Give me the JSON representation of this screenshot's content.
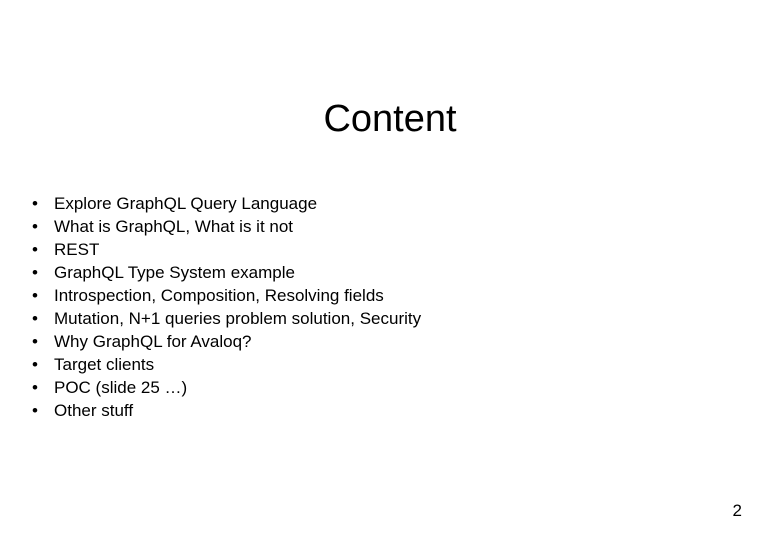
{
  "slide": {
    "title": "Content",
    "page_number": "2",
    "bullet_marker": "•",
    "background_color": "#ffffff",
    "text_color": "#000000",
    "bullets": [
      {
        "label": "Explore GraphQL Query Language"
      },
      {
        "label": "What is GraphQL, What is it not"
      },
      {
        "label": "REST"
      },
      {
        "label": "GraphQL Type System example"
      },
      {
        "label": "Introspection, Composition, Resolving fields"
      },
      {
        "label": "Mutation, N+1 queries problem solution, Security"
      },
      {
        "label": "Why GraphQL for Avaloq?"
      },
      {
        "label": "Target clients"
      },
      {
        "label": "POC (slide 25 …)"
      },
      {
        "label": "Other stuff"
      }
    ]
  }
}
